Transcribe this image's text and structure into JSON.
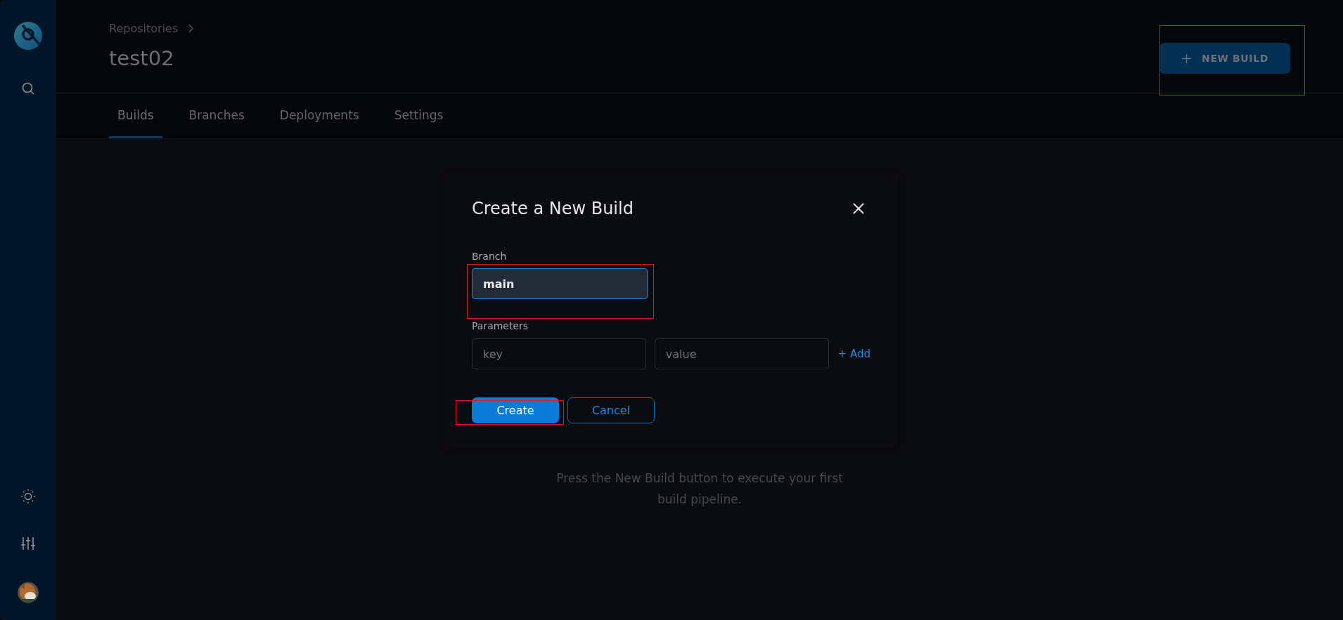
{
  "header": {
    "breadcrumb": "Repositories",
    "title": "test02",
    "new_build_button": "NEW BUILD"
  },
  "tabs": [
    {
      "label": "Builds",
      "selected": true
    },
    {
      "label": "Branches",
      "selected": false
    },
    {
      "label": "Deployments",
      "selected": false
    },
    {
      "label": "Settings",
      "selected": false
    }
  ],
  "empty_state": {
    "message": "Press the New Build button to execute your first build pipeline."
  },
  "dialog": {
    "title": "Create a New Build",
    "branch_label": "Branch",
    "branch_value": "main",
    "parameters_label": "Parameters",
    "key_placeholder": "key",
    "value_placeholder": "value",
    "add_link": "+ Add",
    "buttons": [
      {
        "label": "Create",
        "kind": "primary"
      },
      {
        "label": "Cancel",
        "kind": "secondary"
      }
    ]
  }
}
